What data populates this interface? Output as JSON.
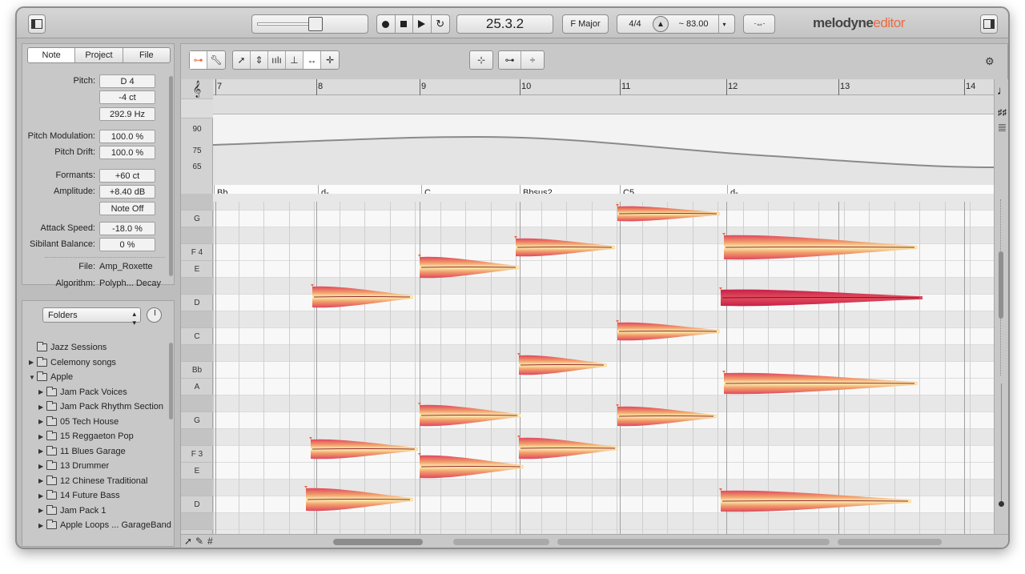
{
  "app": {
    "logo_main": "melodyne",
    "logo_sub": "editor"
  },
  "transport": {
    "position": "25.3.2",
    "key": "F Major",
    "meter": "4/4",
    "tempo": "~ 83.00",
    "record_icon": "record-icon",
    "stop_icon": "stop-icon",
    "play_icon": "play-icon",
    "loop_icon": "loop-icon"
  },
  "inspector": {
    "tabs": [
      "Note",
      "Project",
      "File"
    ],
    "active_tab": "Note",
    "pitch_label": "Pitch:",
    "pitch_note": "D 4",
    "pitch_cents": "-4 ct",
    "pitch_hz": "292.9 Hz",
    "pitch_mod_label": "Pitch Modulation:",
    "pitch_mod": "100.0 %",
    "pitch_drift_label": "Pitch Drift:",
    "pitch_drift": "100.0 %",
    "formants_label": "Formants:",
    "formants": "+60 ct",
    "amplitude_label": "Amplitude:",
    "amplitude": "+8.40 dB",
    "note_off": "Note Off",
    "attack_label": "Attack Speed:",
    "attack": "-18.0 %",
    "sibilant_label": "Sibilant Balance:",
    "sibilant": "0 %",
    "file_label": "File:",
    "file": "Amp_Roxette",
    "algorithm_label": "Algorithm:",
    "algorithm": "Polyph... Decay"
  },
  "browser": {
    "selector": "Folders",
    "items": [
      {
        "label": "Jazz Sessions",
        "level": 0,
        "expander": "none"
      },
      {
        "label": "Celemony songs",
        "level": 0,
        "expander": "collapsed"
      },
      {
        "label": "Apple",
        "level": 0,
        "expander": "expanded"
      },
      {
        "label": "Jam Pack Voices",
        "level": 1,
        "expander": "collapsed"
      },
      {
        "label": "Jam Pack Rhythm Section",
        "level": 1,
        "expander": "collapsed"
      },
      {
        "label": "05 Tech House",
        "level": 1,
        "expander": "collapsed"
      },
      {
        "label": "15 Reggaeton Pop",
        "level": 1,
        "expander": "collapsed"
      },
      {
        "label": "11 Blues Garage",
        "level": 1,
        "expander": "collapsed"
      },
      {
        "label": "13 Drummer",
        "level": 1,
        "expander": "collapsed"
      },
      {
        "label": "12 Chinese Traditional",
        "level": 1,
        "expander": "collapsed"
      },
      {
        "label": "14 Future Bass",
        "level": 1,
        "expander": "collapsed"
      },
      {
        "label": "Jam Pack 1",
        "level": 1,
        "expander": "collapsed"
      },
      {
        "label": "Apple Loops ... GarageBand",
        "level": 1,
        "expander": "collapsed"
      }
    ]
  },
  "ruler": {
    "bars": [
      "7",
      "8",
      "9",
      "10",
      "11",
      "12",
      "13",
      "14"
    ]
  },
  "tempo_scale": [
    "90",
    "75",
    "65"
  ],
  "chords": [
    "Bb",
    "d-",
    "C",
    "Bbsus2",
    "C5",
    "d-"
  ],
  "pitch_rows": [
    {
      "label": "",
      "black": true
    },
    {
      "label": "G",
      "black": false
    },
    {
      "label": "",
      "black": true
    },
    {
      "label": "F 4",
      "black": false
    },
    {
      "label": "E",
      "black": false
    },
    {
      "label": "",
      "black": true
    },
    {
      "label": "D",
      "black": false
    },
    {
      "label": "",
      "black": true
    },
    {
      "label": "C",
      "black": false
    },
    {
      "label": "",
      "black": true
    },
    {
      "label": "Bb",
      "black": false
    },
    {
      "label": "A",
      "black": false
    },
    {
      "label": "",
      "black": true
    },
    {
      "label": "G",
      "black": false
    },
    {
      "label": "",
      "black": true
    },
    {
      "label": "F 3",
      "black": false
    },
    {
      "label": "E",
      "black": false
    },
    {
      "label": "",
      "black": true
    },
    {
      "label": "D",
      "black": false
    },
    {
      "label": "",
      "black": true
    }
  ],
  "colors": {
    "accent": "#e86c44",
    "blob_outer": "#e64a5e",
    "blob_inner": "#fce9a6",
    "blob_selected": "#d42a4d"
  }
}
